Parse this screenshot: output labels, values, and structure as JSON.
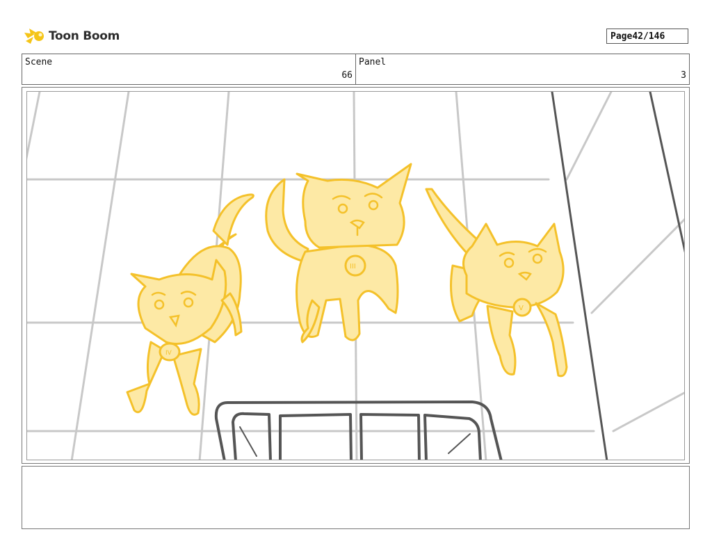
{
  "header": {
    "logo_text": "Toon Boom",
    "page_label": "Page",
    "page_value": "42/146"
  },
  "info": {
    "scene_label": "Scene",
    "scene_value": "66",
    "panel_label": "Panel",
    "panel_value": "3"
  },
  "colors": {
    "sketch_fill": "#fde9a5",
    "sketch_line": "#f4c12a",
    "grid_line": "#c8c8c8",
    "dark_line": "#555555",
    "logo_accent": "#f5c518"
  },
  "icons": {
    "logo": "toon-boom-swoosh-icon"
  },
  "notes": {
    "text": ""
  }
}
